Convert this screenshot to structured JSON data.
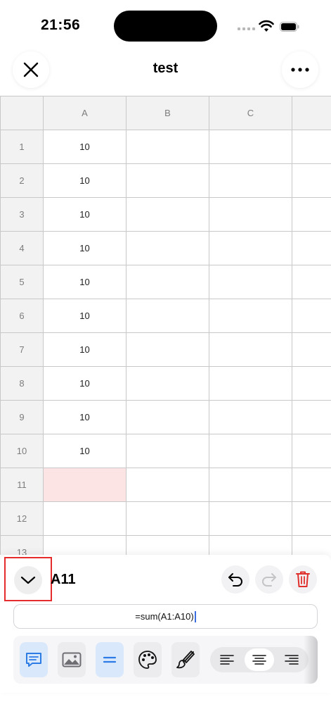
{
  "status_bar": {
    "time": "21:56"
  },
  "nav": {
    "title": "test"
  },
  "grid": {
    "columns": [
      "A",
      "B",
      "C"
    ],
    "rows": [
      {
        "label": "1",
        "a": "10"
      },
      {
        "label": "2",
        "a": "10"
      },
      {
        "label": "3",
        "a": "10"
      },
      {
        "label": "4",
        "a": "10"
      },
      {
        "label": "5",
        "a": "10"
      },
      {
        "label": "6",
        "a": "10"
      },
      {
        "label": "7",
        "a": "10"
      },
      {
        "label": "8",
        "a": "10"
      },
      {
        "label": "9",
        "a": "10"
      },
      {
        "label": "10",
        "a": "10"
      },
      {
        "label": "11",
        "a": ""
      },
      {
        "label": "12",
        "a": ""
      },
      {
        "label": "13",
        "a": ""
      }
    ],
    "selected_cell_color": "#fde4e4"
  },
  "editor": {
    "cell_reference": "A11",
    "formula": "=sum(A1:A10)",
    "highlight_color": "#e52b2b",
    "delete_color": "#e0302c",
    "accent_color": "#2d7be5"
  },
  "toolbar": {
    "tools": [
      "comment-icon",
      "image-icon",
      "equals-icon",
      "palette-icon",
      "brush-icon"
    ],
    "alignment": [
      "align-left-icon",
      "align-center-icon",
      "align-right-icon"
    ],
    "selected_alignment": "center"
  }
}
